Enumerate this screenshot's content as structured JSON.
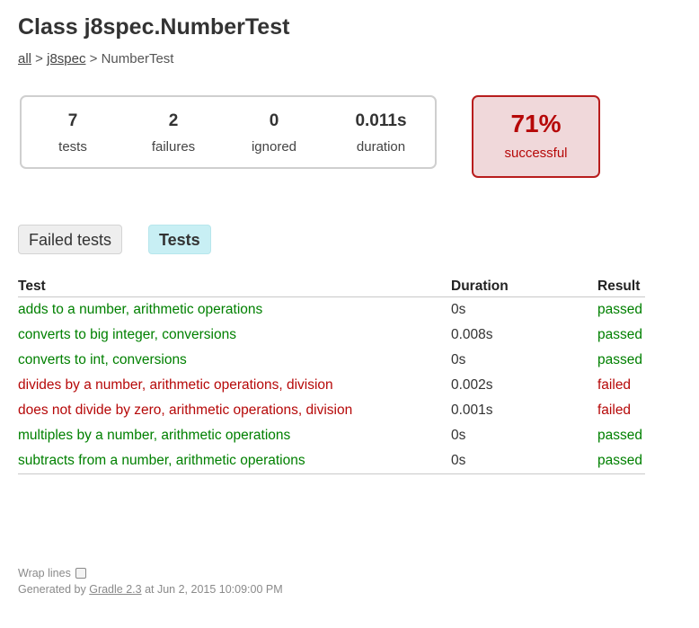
{
  "header": {
    "title": "Class j8spec.NumberTest",
    "breadcrumb": {
      "all": "all",
      "sep1": " > ",
      "package": "j8spec",
      "sep2": " > ",
      "current": "NumberTest"
    }
  },
  "summary": {
    "tests": {
      "value": "7",
      "label": "tests"
    },
    "failures": {
      "value": "2",
      "label": "failures"
    },
    "ignored": {
      "value": "0",
      "label": "ignored"
    },
    "duration": {
      "value": "0.011s",
      "label": "duration"
    },
    "success_rate": {
      "value": "71%",
      "label": "successful",
      "color": "#b60808",
      "background": "#f0d8da"
    }
  },
  "tabs": [
    {
      "label": "Failed tests",
      "selected": false
    },
    {
      "label": "Tests",
      "selected": true
    }
  ],
  "table": {
    "headers": {
      "test": "Test",
      "duration": "Duration",
      "result": "Result"
    },
    "rows": [
      {
        "test": "adds to a number, arithmetic operations",
        "duration": "0s",
        "result": "passed"
      },
      {
        "test": "converts to big integer, conversions",
        "duration": "0.008s",
        "result": "passed"
      },
      {
        "test": "converts to int, conversions",
        "duration": "0s",
        "result": "passed"
      },
      {
        "test": "divides by a number, arithmetic operations, division",
        "duration": "0.002s",
        "result": "failed"
      },
      {
        "test": "does not divide by zero, arithmetic operations, division",
        "duration": "0.001s",
        "result": "failed"
      },
      {
        "test": "multiples by a number, arithmetic operations",
        "duration": "0s",
        "result": "passed"
      },
      {
        "test": "subtracts from a number, arithmetic operations",
        "duration": "0s",
        "result": "passed"
      }
    ]
  },
  "footer": {
    "wrap_label": "Wrap lines",
    "generated_prefix": "Generated by ",
    "gradle_link": "Gradle 2.3",
    "generated_suffix": " at Jun 2, 2015 10:09:00 PM"
  },
  "colors": {
    "passed": "#008000",
    "failed": "#b60808",
    "selected_tab": "#c8eff4"
  }
}
